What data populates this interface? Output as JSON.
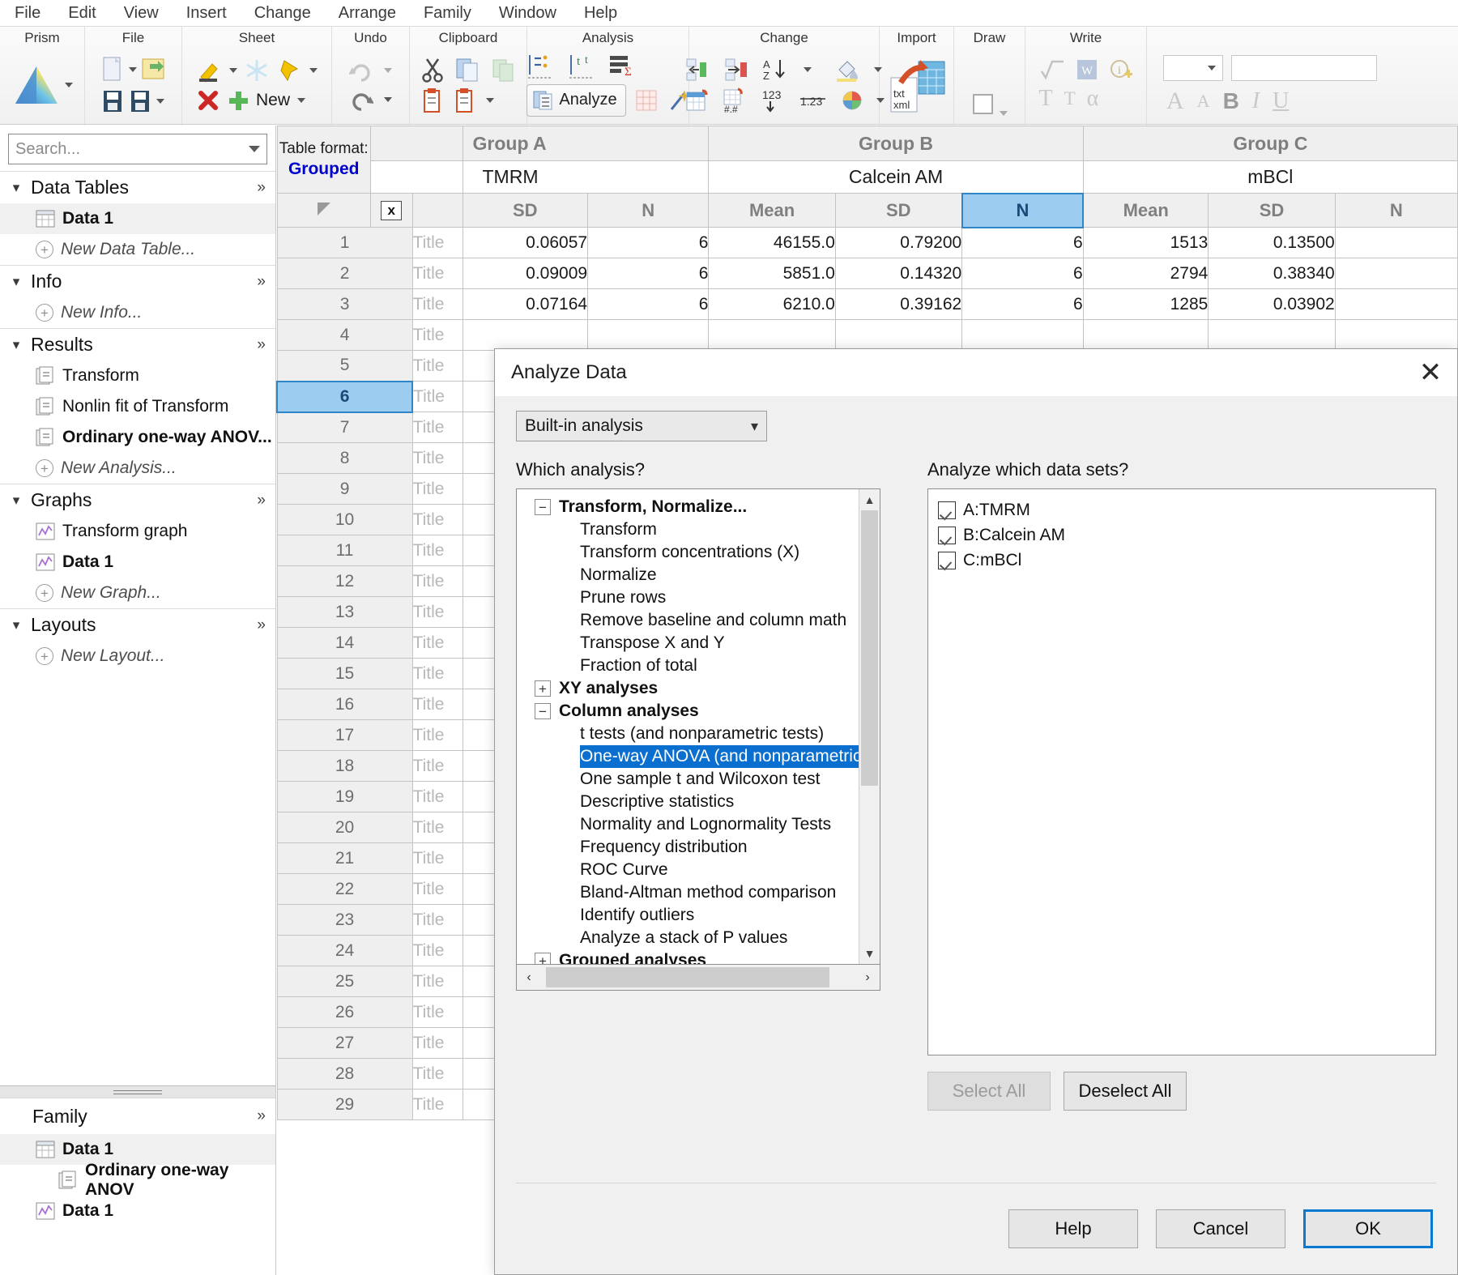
{
  "menubar": {
    "items": [
      "File",
      "Edit",
      "View",
      "Insert",
      "Change",
      "Arrange",
      "Family",
      "Window",
      "Help"
    ]
  },
  "ribbon": {
    "groups": [
      "Prism",
      "File",
      "Sheet",
      "Undo",
      "Clipboard",
      "Analysis",
      "Change",
      "Import",
      "Draw",
      "Write"
    ],
    "analyze_label": "Analyze",
    "new_label": "New",
    "import_txt": "txt",
    "import_xml": "xml",
    "number_123": "123",
    "number_dec": "1.23",
    "hash": "#.#"
  },
  "sidebar": {
    "search_placeholder": "Search...",
    "overflow": "»",
    "sections": [
      {
        "label": "Data Tables",
        "items": [
          {
            "label": "Data 1",
            "style": "bold",
            "icon": "table-icon",
            "selected": true
          },
          {
            "label": "New Data Table...",
            "style": "new",
            "icon": "plus-icon"
          }
        ]
      },
      {
        "label": "Info",
        "items": [
          {
            "label": "New Info...",
            "style": "new",
            "icon": "plus-icon"
          }
        ]
      },
      {
        "label": "Results",
        "items": [
          {
            "label": "Transform",
            "style": "normal",
            "icon": "results-icon"
          },
          {
            "label": "Nonlin fit of Transform",
            "style": "normal",
            "icon": "results-icon"
          },
          {
            "label": "Ordinary one-way ANOV...",
            "style": "bold",
            "icon": "results-icon"
          },
          {
            "label": "New Analysis...",
            "style": "new",
            "icon": "plus-icon"
          }
        ]
      },
      {
        "label": "Graphs",
        "items": [
          {
            "label": "Transform graph",
            "style": "normal",
            "icon": "graph-icon"
          },
          {
            "label": "Data 1",
            "style": "bold",
            "icon": "graph-icon"
          },
          {
            "label": "New Graph...",
            "style": "new",
            "icon": "plus-icon"
          }
        ]
      },
      {
        "label": "Layouts",
        "items": [
          {
            "label": "New Layout...",
            "style": "new",
            "icon": "plus-icon"
          }
        ]
      }
    ],
    "family": {
      "title": "Family",
      "overflow": "»",
      "items": [
        {
          "label": "Data 1",
          "icon": "table-icon",
          "indent": 1,
          "bold": true,
          "selected": true
        },
        {
          "label": "Ordinary one-way ANOV",
          "icon": "results-icon",
          "indent": 2,
          "bold": true
        },
        {
          "label": "Data 1",
          "icon": "graph-icon",
          "indent": 1,
          "bold": true
        }
      ]
    }
  },
  "sheet": {
    "table_format_label": "Table format:",
    "table_format_value": "Grouped",
    "close_col_label": "x",
    "groups": [
      {
        "group": "Group A",
        "title": "TMRM"
      },
      {
        "group": "Group B",
        "title": "Calcein AM"
      },
      {
        "group": "Group C",
        "title": "mBCl"
      }
    ],
    "subheaders": [
      "SD",
      "N",
      "Mean",
      "SD",
      "N",
      "Mean",
      "SD",
      "N"
    ],
    "selected_subheader_index": 4,
    "selected_row_index": 6,
    "row_title_placeholder": "Title",
    "row_numbers": [
      1,
      2,
      3,
      4,
      5,
      6,
      7,
      8,
      9,
      10,
      11,
      12,
      13,
      14,
      15,
      16,
      17,
      18,
      19,
      20,
      21,
      22,
      23,
      24,
      25,
      26,
      27,
      28,
      29
    ],
    "rows": [
      [
        "0.06057",
        "6",
        "46155.0",
        "0.79200",
        "6",
        "1513",
        "0.13500",
        ""
      ],
      [
        "0.09009",
        "6",
        "5851.0",
        "0.14320",
        "6",
        "2794",
        "0.38340",
        ""
      ],
      [
        "0.07164",
        "6",
        "6210.0",
        "0.39162",
        "6",
        "1285",
        "0.03902",
        ""
      ]
    ]
  },
  "dialog": {
    "title": "Analyze Data",
    "close_icon": "✕",
    "source_combo": "Built-in analysis",
    "which_analysis_label": "Which analysis?",
    "which_datasets_label": "Analyze which data sets?",
    "analysis_tree": [
      {
        "label": "Transform, Normalize...",
        "type": "group",
        "expander": "−"
      },
      {
        "label": "Transform",
        "type": "child"
      },
      {
        "label": "Transform concentrations (X)",
        "type": "child"
      },
      {
        "label": "Normalize",
        "type": "child"
      },
      {
        "label": "Prune rows",
        "type": "child"
      },
      {
        "label": "Remove baseline and column math",
        "type": "child"
      },
      {
        "label": "Transpose X and Y",
        "type": "child"
      },
      {
        "label": "Fraction of total",
        "type": "child"
      },
      {
        "label": "XY analyses",
        "type": "group",
        "expander": "+"
      },
      {
        "label": "Column analyses",
        "type": "group",
        "expander": "−"
      },
      {
        "label": "t tests (and nonparametric tests)",
        "type": "child"
      },
      {
        "label": "One-way ANOVA (and nonparametric or",
        "type": "child",
        "selected": true
      },
      {
        "label": "One sample t and Wilcoxon test",
        "type": "child"
      },
      {
        "label": "Descriptive statistics",
        "type": "child"
      },
      {
        "label": "Normality and Lognormality Tests",
        "type": "child"
      },
      {
        "label": "Frequency distribution",
        "type": "child"
      },
      {
        "label": "ROC Curve",
        "type": "child"
      },
      {
        "label": "Bland-Altman method comparison",
        "type": "child"
      },
      {
        "label": "Identify outliers",
        "type": "child"
      },
      {
        "label": "Analyze a stack of P values",
        "type": "child"
      },
      {
        "label": "Grouped analyses",
        "type": "group",
        "expander": "+"
      }
    ],
    "datasets": [
      {
        "label": "A:TMRM",
        "checked": true
      },
      {
        "label": "B:Calcein AM",
        "checked": true
      },
      {
        "label": "C:mBCl",
        "checked": true
      }
    ],
    "select_all_label": "Select All",
    "deselect_all_label": "Deselect All",
    "help_label": "Help",
    "cancel_label": "Cancel",
    "ok_label": "OK",
    "scroll_left_icon": "‹",
    "scroll_right_icon": "›",
    "scroll_up_icon": "▲",
    "scroll_down_icon": "▼"
  },
  "colors": {
    "accent_blue": "#0a6fcf",
    "selection_blue": "#9ccdf0",
    "grouped_blue": "#0000cc",
    "ok_border": "#0a7ad1"
  }
}
